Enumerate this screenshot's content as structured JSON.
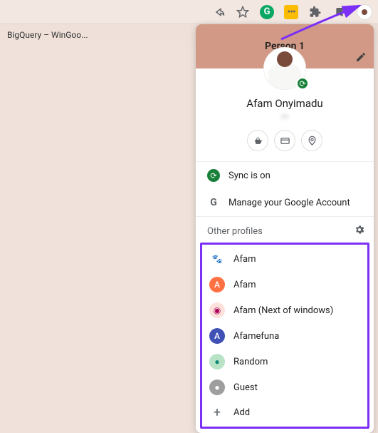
{
  "toolbar": {
    "grammarly_letter": "G",
    "yellow_ext": "•••"
  },
  "tab": {
    "title": "BigQuery – WinGoo..."
  },
  "panel": {
    "title": "Person 1",
    "name": "Afam Onyimadu",
    "email_obscured": "m",
    "sync_label": "Sync is on",
    "manage_label": "Manage your Google Account",
    "other_profiles_label": "Other profiles",
    "add_label": "Add"
  },
  "profiles": [
    {
      "name": "Afam",
      "color": "#ffffff",
      "textcolor": "#333",
      "letter": "🐾"
    },
    {
      "name": "Afam",
      "color": "#ff7043",
      "letter": "A"
    },
    {
      "name": "Afam (Next of windows)",
      "color": "#ffe1dc",
      "textcolor": "#a05",
      "letter": "◉"
    },
    {
      "name": "Afamefuna",
      "color": "#3f51b5",
      "letter": "A"
    },
    {
      "name": "Random",
      "color": "#b8e3c7",
      "textcolor": "#187",
      "letter": "●"
    },
    {
      "name": "Guest",
      "color": "#9e9e9e",
      "letter": "●"
    }
  ]
}
